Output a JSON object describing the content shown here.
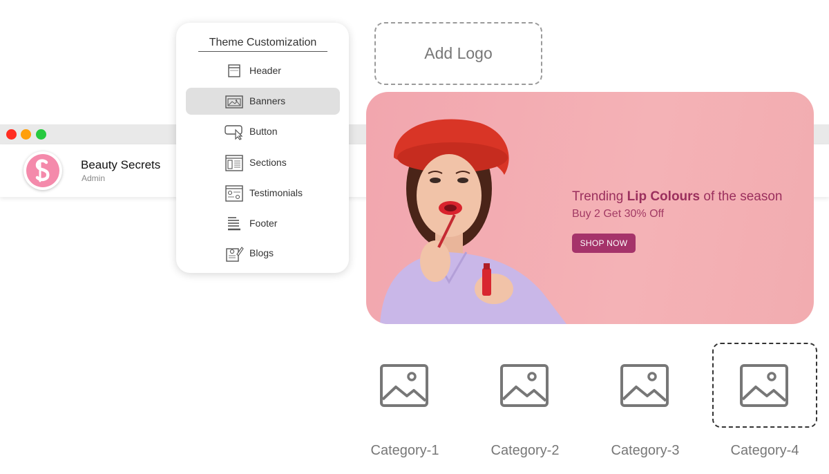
{
  "window": {
    "controls": [
      "close",
      "minimize",
      "maximize"
    ]
  },
  "profile": {
    "name": "Beauty Secrets",
    "role": "Admin",
    "brand_color": "#f48aab"
  },
  "panel": {
    "title": "Theme Customization",
    "items": [
      {
        "label": "Header",
        "icon": "header-layout-icon",
        "active": false
      },
      {
        "label": "Banners",
        "icon": "banner-image-icon",
        "active": true
      },
      {
        "label": "Button",
        "icon": "button-cursor-icon",
        "active": false
      },
      {
        "label": "Sections",
        "icon": "sections-layout-icon",
        "active": false
      },
      {
        "label": "Testimonials",
        "icon": "testimonials-icon",
        "active": false
      },
      {
        "label": "Footer",
        "icon": "footer-lines-icon",
        "active": false
      },
      {
        "label": "Blogs",
        "icon": "blog-edit-icon",
        "active": false
      }
    ]
  },
  "logo_placeholder": {
    "label": "Add Logo"
  },
  "banner": {
    "headline_pre": "Trending ",
    "headline_bold": "Lip Colours",
    "headline_post": " of the season",
    "offer": "Buy 2 Get 30% Off",
    "cta": "SHOP NOW",
    "background": "#f4b2b6",
    "accent": "#a5336a"
  },
  "categories": [
    {
      "label": "Category-1",
      "selected": false
    },
    {
      "label": "Category-2",
      "selected": false
    },
    {
      "label": "Category-3",
      "selected": false
    },
    {
      "label": "Category-4",
      "selected": true
    }
  ]
}
